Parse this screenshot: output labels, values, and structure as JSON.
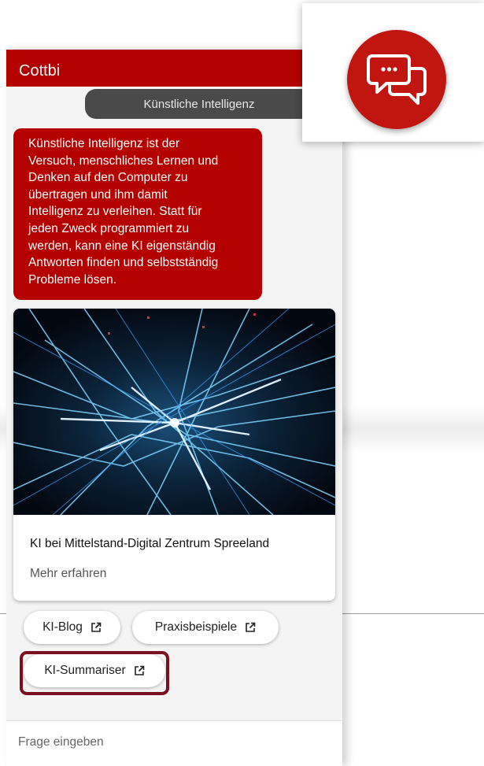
{
  "chat": {
    "header_title": "Cottbi",
    "topic_pill": "Künstliche Intelligenz",
    "bot_message_lines": [
      "Künstliche Intelligenz ist der",
      "Versuch, menschliches Lernen und",
      "Denken auf den Computer zu",
      "übertragen und ihm damit",
      "Intelligenz zu verleihen. Statt für",
      "jeden Zweck programmiert zu",
      "werden, kann eine KI eigenständig",
      "Antworten finden und selbstständig",
      "Probleme lösen."
    ],
    "card": {
      "title": "KI bei Mittelstand-Digital Zentrum Spreeland",
      "link": "Mehr erfahren"
    },
    "chips": [
      {
        "label": "KI-Blog"
      },
      {
        "label": "Praxisbeispiele"
      },
      {
        "label": "KI-Summariser"
      }
    ],
    "input": {
      "placeholder": "Frage eingeben",
      "value": ""
    }
  },
  "colors": {
    "brand_red": "#b50000",
    "launcher_red": "#c1150f",
    "highlight_border": "#7a0f1f",
    "pill_bg": "#4a4a4a"
  },
  "icons": {
    "chip_icon": "external-link-icon",
    "launcher_icon": "chat-bubbles-icon"
  }
}
